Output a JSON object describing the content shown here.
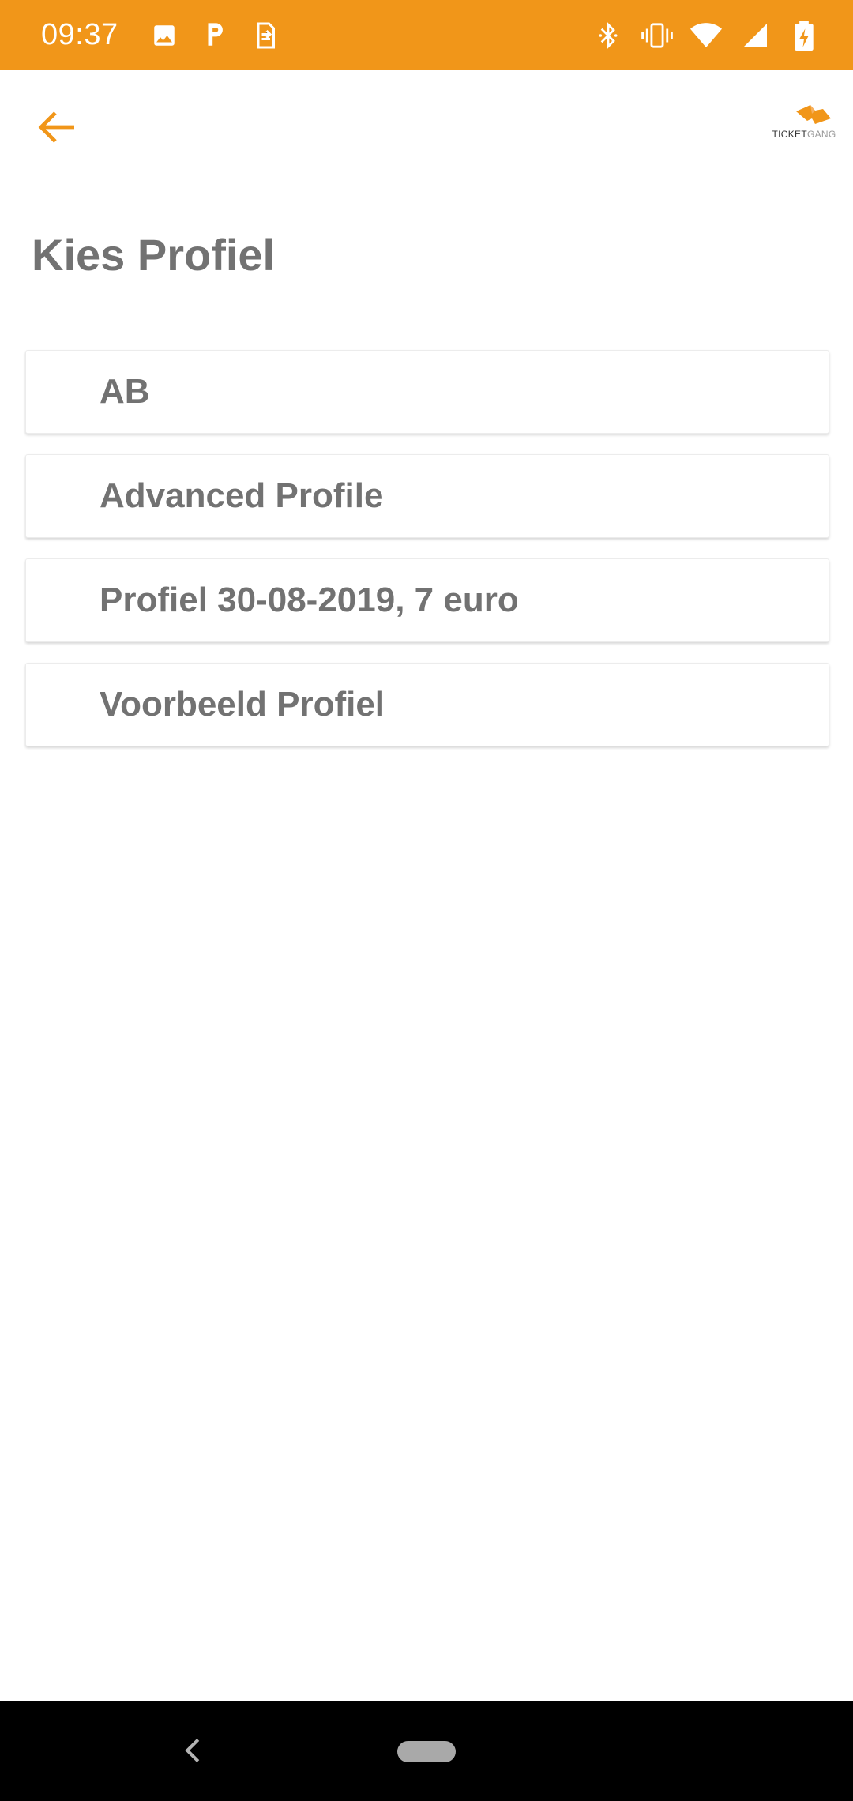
{
  "status_bar": {
    "time": "09:37",
    "left_icons": [
      "image-icon",
      "parking-icon",
      "sim-transfer-icon"
    ],
    "right_icons": [
      "bluetooth-icon",
      "vibrate-icon",
      "wifi-icon",
      "signal-icon",
      "battery-charging-icon"
    ]
  },
  "app_bar": {
    "back_icon": "arrow-left-icon",
    "logo": "ticketgang-logo",
    "logo_text_part1": "TICKET",
    "logo_text_part2": "GANG"
  },
  "page": {
    "title": "Kies Profiel"
  },
  "profiles": [
    {
      "label": "AB"
    },
    {
      "label": "Advanced Profile"
    },
    {
      "label": "Profiel 30-08-2019, 7 euro"
    },
    {
      "label": "Voorbeeld Profiel"
    }
  ],
  "nav_bar": {
    "back_icon": "chevron-left-icon",
    "home_pill": "home-pill"
  },
  "colors": {
    "accent": "#f19619",
    "text": "#727272",
    "nav_bg": "#000000"
  }
}
